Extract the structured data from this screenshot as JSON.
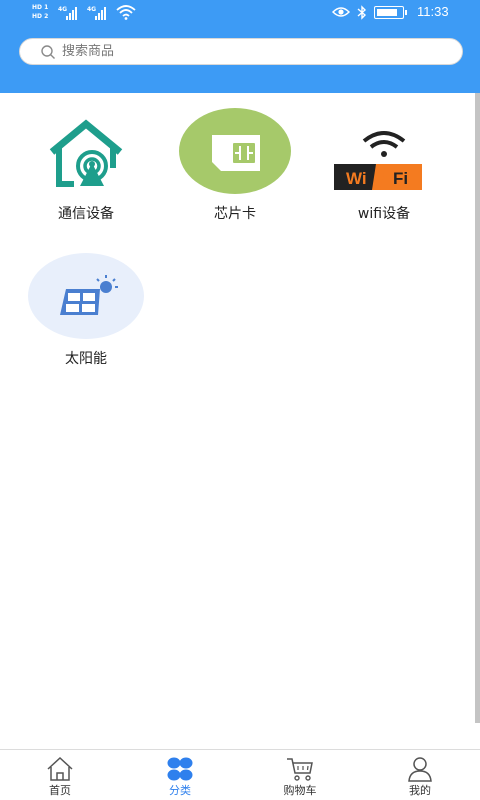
{
  "status_bar": {
    "hd1": "HD 1",
    "hd2": "HD 2",
    "net1": "4G",
    "net2": "4G",
    "time": "11:33",
    "battery_level": 0.85
  },
  "search": {
    "placeholder": "搜索商品"
  },
  "categories": [
    {
      "label": "通信设备",
      "icon": "home-antenna-icon"
    },
    {
      "label": "芯片卡",
      "icon": "sim-card-icon"
    },
    {
      "label": "wifi设备",
      "icon": "wifi-sign-icon",
      "icon_text_left": "Wi",
      "icon_text_right": "Fi"
    },
    {
      "label": "太阳能",
      "icon": "solar-panel-icon"
    }
  ],
  "tabs": [
    {
      "label": "首页",
      "icon": "home-icon",
      "active": false
    },
    {
      "label": "分类",
      "icon": "category-icon",
      "active": true
    },
    {
      "label": "购物车",
      "icon": "cart-icon",
      "active": false
    },
    {
      "label": "我的",
      "icon": "user-icon",
      "active": false
    }
  ],
  "colors": {
    "header": "#3d9bf5",
    "active_tab": "#2f80ed",
    "teal": "#1e9e8c",
    "sim_green": "#a6c96a",
    "solar_blue": "#4a7fd0"
  }
}
